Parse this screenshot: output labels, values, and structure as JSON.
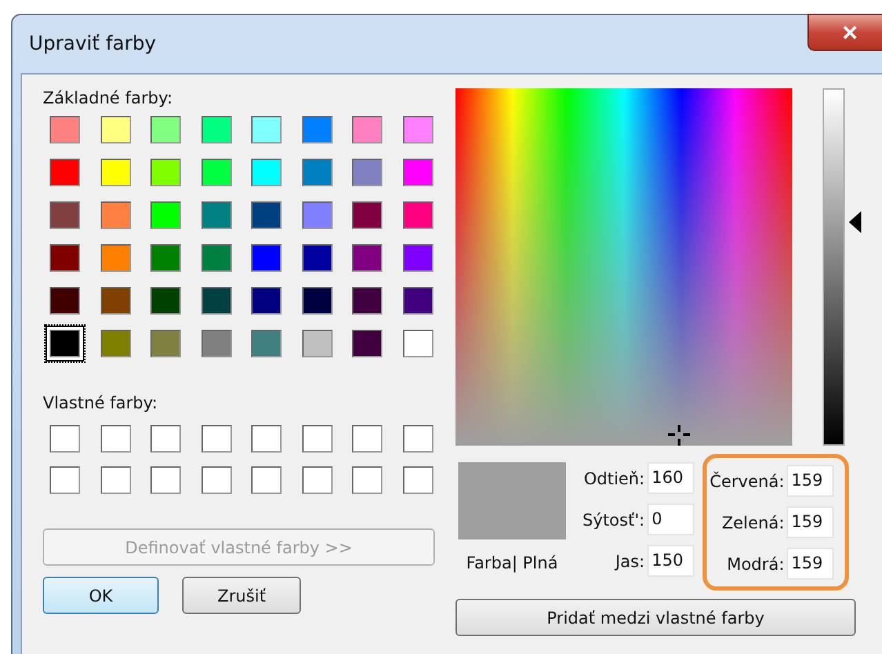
{
  "window": {
    "title": "Upraviť farby",
    "close": "✕"
  },
  "basic_colors": {
    "label": "Základné farby:",
    "swatches": [
      {
        "color": "#ff8080",
        "selected": false
      },
      {
        "color": "#ffff80",
        "selected": false
      },
      {
        "color": "#80ff80",
        "selected": false
      },
      {
        "color": "#00ff80",
        "selected": false
      },
      {
        "color": "#80ffff",
        "selected": false
      },
      {
        "color": "#0080ff",
        "selected": false
      },
      {
        "color": "#ff80c0",
        "selected": false
      },
      {
        "color": "#ff80ff",
        "selected": false
      },
      {
        "color": "#ff0000",
        "selected": false
      },
      {
        "color": "#ffff00",
        "selected": false
      },
      {
        "color": "#80ff00",
        "selected": false
      },
      {
        "color": "#00ff40",
        "selected": false
      },
      {
        "color": "#00ffff",
        "selected": false
      },
      {
        "color": "#0080c0",
        "selected": false
      },
      {
        "color": "#8080c0",
        "selected": false
      },
      {
        "color": "#ff00ff",
        "selected": false
      },
      {
        "color": "#804040",
        "selected": false
      },
      {
        "color": "#ff8040",
        "selected": false
      },
      {
        "color": "#00ff00",
        "selected": false
      },
      {
        "color": "#008080",
        "selected": false
      },
      {
        "color": "#004080",
        "selected": false
      },
      {
        "color": "#8080ff",
        "selected": false
      },
      {
        "color": "#800040",
        "selected": false
      },
      {
        "color": "#ff0080",
        "selected": false
      },
      {
        "color": "#800000",
        "selected": false
      },
      {
        "color": "#ff8000",
        "selected": false
      },
      {
        "color": "#008000",
        "selected": false
      },
      {
        "color": "#008040",
        "selected": false
      },
      {
        "color": "#0000ff",
        "selected": false
      },
      {
        "color": "#0000a0",
        "selected": false
      },
      {
        "color": "#800080",
        "selected": false
      },
      {
        "color": "#8000ff",
        "selected": false
      },
      {
        "color": "#400000",
        "selected": false
      },
      {
        "color": "#804000",
        "selected": false
      },
      {
        "color": "#004000",
        "selected": false
      },
      {
        "color": "#004040",
        "selected": false
      },
      {
        "color": "#000080",
        "selected": false
      },
      {
        "color": "#000040",
        "selected": false
      },
      {
        "color": "#400040",
        "selected": false
      },
      {
        "color": "#400080",
        "selected": false
      },
      {
        "color": "#000000",
        "selected": true
      },
      {
        "color": "#808000",
        "selected": false
      },
      {
        "color": "#808040",
        "selected": false
      },
      {
        "color": "#808080",
        "selected": false
      },
      {
        "color": "#408080",
        "selected": false
      },
      {
        "color": "#c0c0c0",
        "selected": false
      },
      {
        "color": "#400040",
        "selected": false
      },
      {
        "color": "#ffffff",
        "selected": false
      }
    ]
  },
  "custom_colors": {
    "label": "Vlastné farby:",
    "swatches": [
      {
        "color": "#ffffff"
      },
      {
        "color": "#ffffff"
      },
      {
        "color": "#ffffff"
      },
      {
        "color": "#ffffff"
      },
      {
        "color": "#ffffff"
      },
      {
        "color": "#ffffff"
      },
      {
        "color": "#ffffff"
      },
      {
        "color": "#ffffff"
      },
      {
        "color": "#ffffff"
      },
      {
        "color": "#ffffff"
      },
      {
        "color": "#ffffff"
      },
      {
        "color": "#ffffff"
      },
      {
        "color": "#ffffff"
      },
      {
        "color": "#ffffff"
      },
      {
        "color": "#ffffff"
      },
      {
        "color": "#ffffff"
      }
    ]
  },
  "define_button": {
    "label": "Definovať vlastné farby >>",
    "disabled": true
  },
  "buttons": [
    {
      "label": "OK",
      "default": true
    },
    {
      "label": "Zrušiť",
      "default": false
    }
  ],
  "luminance": {
    "level": 0.625
  },
  "preview": {
    "color": "#9f9f9f",
    "label": "Farba| Plná"
  },
  "hsl_fields": [
    {
      "label": "Odtieň:",
      "value": "160"
    },
    {
      "label": "Sýtosť':",
      "value": "0"
    },
    {
      "label": "Jas:",
      "value": "150"
    }
  ],
  "rgb_fields": [
    {
      "label": "Červená:",
      "value": "159"
    },
    {
      "label": "Zelená:",
      "value": "159"
    },
    {
      "label": "Modrá:",
      "value": "159"
    }
  ],
  "rgb_highlighted": true,
  "add_button": {
    "label": "Pridať medzi vlastné farby"
  }
}
